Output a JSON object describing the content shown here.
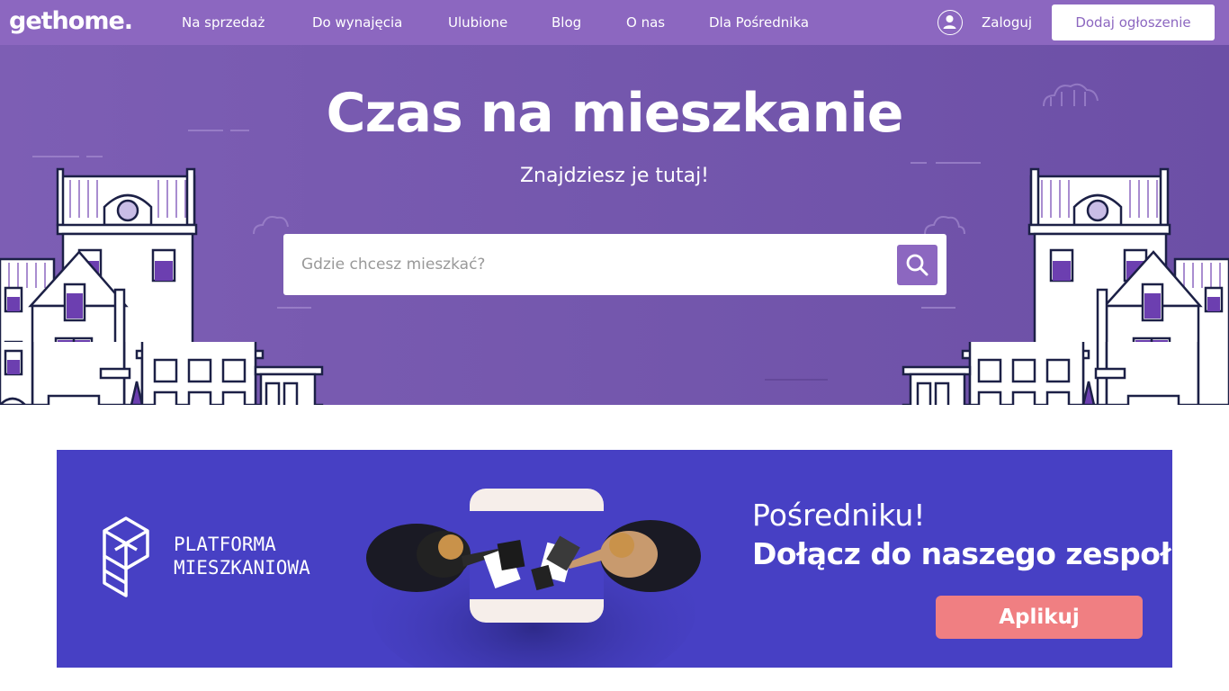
{
  "header": {
    "logo": "gethome.",
    "nav": [
      {
        "label": "Na sprzedaż"
      },
      {
        "label": "Do wynajęcia"
      },
      {
        "label": "Ulubione"
      },
      {
        "label": "Blog"
      },
      {
        "label": "O nas"
      },
      {
        "label": "Dla Pośrednika"
      }
    ],
    "login_label": "Zaloguj",
    "add_listing_label": "Dodaj ogłoszenie"
  },
  "hero": {
    "title": "Czas na mieszkanie",
    "subtitle": "Znajdziesz je tutaj!",
    "search": {
      "placeholder": "Gdzie chcesz mieszkać?",
      "button_icon": "search-icon"
    }
  },
  "banner": {
    "logo_line1": "PLATFORMA",
    "logo_line2": "MIESZKANIOWA",
    "subtitle": "Pośredniku!",
    "title": "Dołącz do naszego zespołu!",
    "button_label": "Aplikuj"
  },
  "colors": {
    "brand": "#8c67c0",
    "banner_bg": "#4740c4",
    "cta": "#f07f82"
  }
}
